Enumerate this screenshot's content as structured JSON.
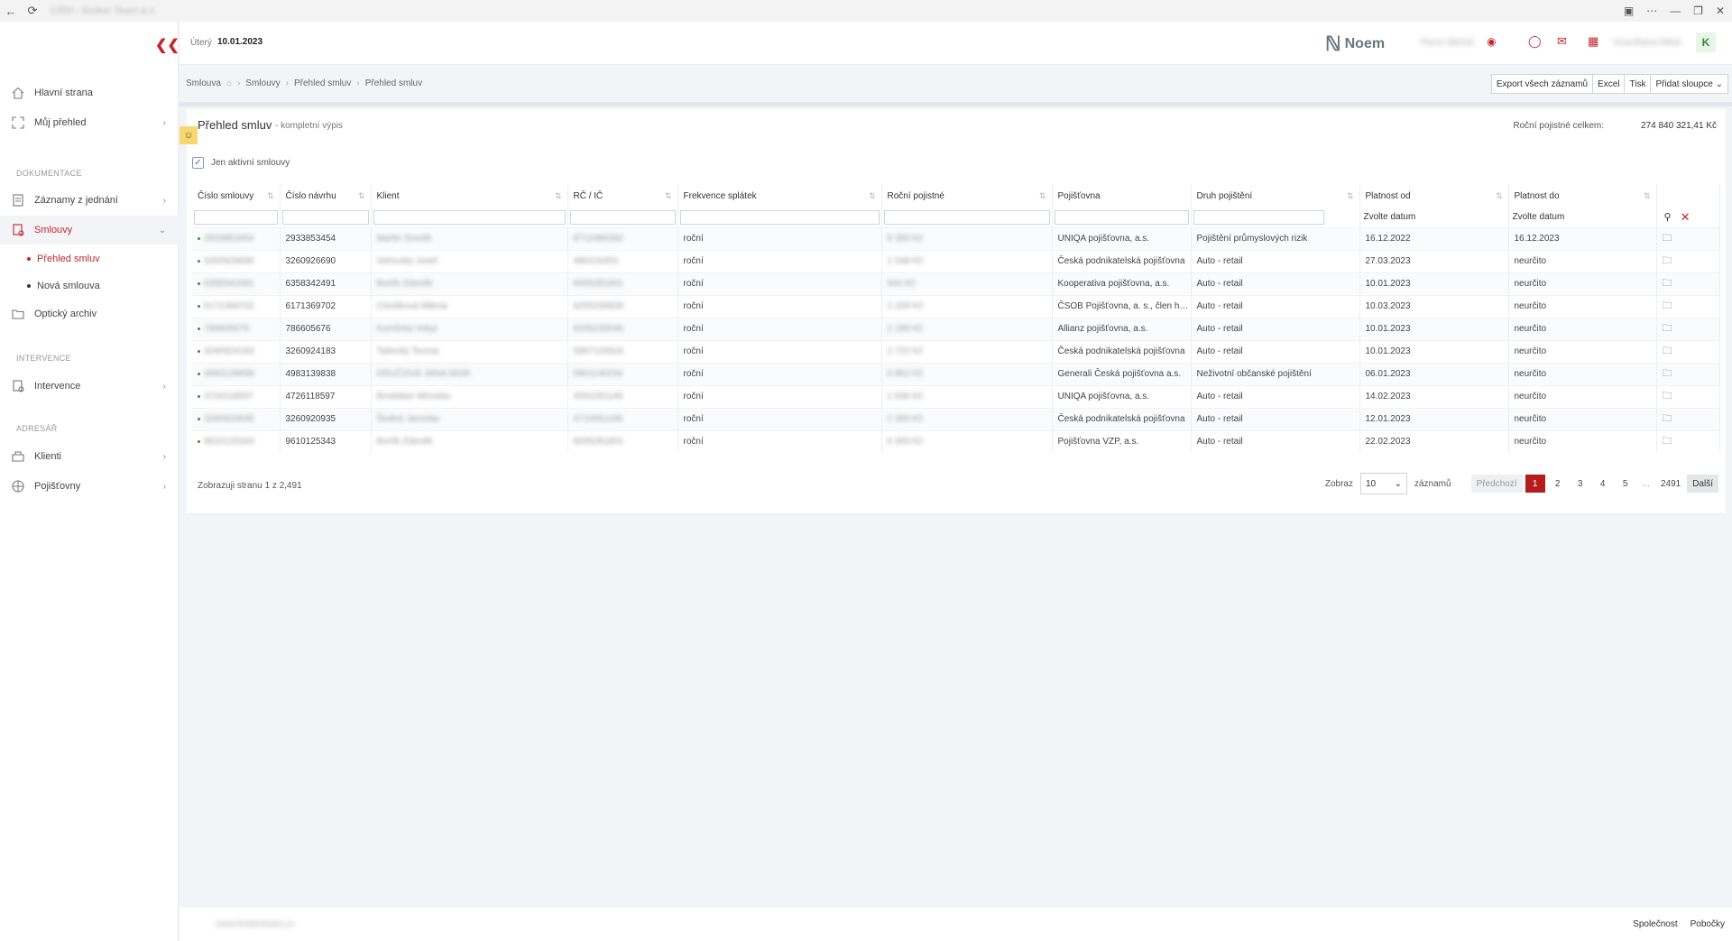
{
  "browser": {
    "title": "CRM - Broker Team a.s.",
    "back_icon": "arrow-left-icon",
    "reload_icon": "reload-icon"
  },
  "sidebar": {
    "items": [
      {
        "label": "Hlavní strana",
        "icon": "home-icon"
      },
      {
        "label": "Můj přehled",
        "icon": "expand-icon"
      },
      {
        "label": "Záznamy z jednání",
        "icon": "document-icon"
      },
      {
        "label": "Smlouvy",
        "icon": "contract-icon"
      },
      {
        "label": "Optický archiv",
        "icon": "folder-icon"
      },
      {
        "label": "Intervence",
        "icon": "intervention-icon"
      },
      {
        "label": "Klienti",
        "icon": "clients-icon"
      },
      {
        "label": "Pojišťovny",
        "icon": "globe-icon"
      }
    ],
    "sections": {
      "dokumentace": "DOKUMENTACE",
      "intervence": "INTERVENCE",
      "adresar": "ADRESÁŘ"
    },
    "sub_items": [
      {
        "label": "Přehled smluv"
      },
      {
        "label": "Nová smlouva"
      }
    ]
  },
  "header": {
    "day": "Úterý",
    "date": "10.01.2023",
    "logo": "Noem",
    "user_blur": "Pierre Michal",
    "user_name": "Kravdhana Miloš",
    "avatar": "K"
  },
  "breadcrumb": [
    "Smlouva",
    "Smlouvy",
    "Přehled smluv",
    "Přehled smluv"
  ],
  "actions": [
    "Export všech záznamů",
    "Excel",
    "Tisk",
    "Přidat sloupce"
  ],
  "card": {
    "title": "Přehled smluv",
    "subtitle": "- kompletní výpis",
    "total_label": "Roční pojistné celkem:",
    "total_value": "274 840 321,41 Kč",
    "only_active": "Jen aktivní smlouvy"
  },
  "table": {
    "columns": [
      "Číslo smlouvy",
      "Číslo návrhu",
      "Klient",
      "RČ / IČ",
      "Frekvence splátek",
      "Roční pojistné",
      "Pojišťovna",
      "Druh pojištění",
      "Platnost od",
      "Platnost do"
    ],
    "date_placeholder": "Zvolte datum",
    "rows": [
      {
        "cislo": "2933853454",
        "navrh": "2933853454",
        "klient": "Martin Smolík",
        "rc": "8712480392",
        "frekvence": "roční",
        "pojistne": "8 350 Kč",
        "pojistovna": "UNIQA pojišťovna, a.s.",
        "druh": "Pojištění průmyslových rizik",
        "od": "16.12.2022",
        "do": "16.12.2023"
      },
      {
        "cislo": "3260926690",
        "navrh": "3260926690",
        "klient": "Veřovský Josef",
        "rc": "480116453",
        "frekvence": "roční",
        "pojistne": "1 548 Kč",
        "pojistovna": "Česká podnikatelská pojišťovna",
        "druh": "Auto - retail",
        "od": "27.03.2023",
        "do": "neurčito"
      },
      {
        "cislo": "6358342491",
        "navrh": "6358342491",
        "klient": "Bortík Zdeněk",
        "rc": "6005281801",
        "frekvence": "roční",
        "pojistne": "944 Kč",
        "pojistovna": "Kooperativa pojišťovna, a.s.",
        "druh": "Auto - retail",
        "od": "10.01.2023",
        "do": "neurčito"
      },
      {
        "cislo": "6171369702",
        "navrh": "6171369702",
        "klient": "Cieslíková Milena",
        "rc": "6255230828",
        "frekvence": "roční",
        "pojistne": "2 228 Kč",
        "pojistovna": "ČSOB Pojišťovna, a. s., člen holdingu ČSOB",
        "druh": "Auto - retail",
        "od": "10.03.2023",
        "do": "neurčito"
      },
      {
        "cislo": "786605676",
        "navrh": "786605676",
        "klient": "Komůrka Vokyl",
        "rc": "6205230046",
        "frekvence": "roční",
        "pojistne": "2 188 Kč",
        "pojistovna": "Allianz pojišťovna, a.s.",
        "druh": "Auto - retail",
        "od": "10.01.2023",
        "do": "neurčito"
      },
      {
        "cislo": "3260924183",
        "navrh": "3260924183",
        "klient": "Tašecký Tereza",
        "rc": "5957120923",
        "frekvence": "roční",
        "pojistne": "2 722 Kč",
        "pojistovna": "Česká podnikatelská pojišťovna",
        "druh": "Auto - retail",
        "od": "10.01.2023",
        "do": "neurčito"
      },
      {
        "cislo": "4983139838",
        "navrh": "4983139838",
        "klient": "KRUČOVÁ JANA MGR.",
        "rc": "5901140234",
        "frekvence": "roční",
        "pojistne": "6 852 Kč",
        "pojistovna": "Generali Česká pojišťovna a.s.",
        "druh": "Neživotní občanské pojištění",
        "od": "06.01.2023",
        "do": "neurčito"
      },
      {
        "cislo": "4726118597",
        "navrh": "4726118597",
        "klient": "Brodskier Miroslav",
        "rc": "4002281145",
        "frekvence": "roční",
        "pojistne": "1 836 Kč",
        "pojistovna": "UNIQA pojišťovna, a.s.",
        "druh": "Auto - retail",
        "od": "14.02.2023",
        "do": "neurčito"
      },
      {
        "cislo": "3260920935",
        "navrh": "3260920935",
        "klient": "Šedivý Jaroslav",
        "rc": "4710051166",
        "frekvence": "roční",
        "pojistne": "2 305 Kč",
        "pojistovna": "Česká podnikatelská pojišťovna",
        "druh": "Auto - retail",
        "od": "12.01.2023",
        "do": "neurčito"
      },
      {
        "cislo": "9610125343",
        "navrh": "9610125343",
        "klient": "Bortík Zdeněk",
        "rc": "6005281801",
        "frekvence": "roční",
        "pojistne": "6 300 Kč",
        "pojistovna": "Pojišťovna VZP, a.s.",
        "druh": "Auto - retail",
        "od": "22.02.2023",
        "do": "neurčito"
      }
    ]
  },
  "pager": {
    "info": "Zobrazuji stranu 1 z 2,491",
    "show_label": "Zobraz",
    "page_size": "10",
    "records_label": "záznamů",
    "prev": "Předchozí",
    "pages": [
      "1",
      "2",
      "3",
      "4",
      "5"
    ],
    "ellipsis": "...",
    "last": "2491",
    "next": "Další"
  },
  "footer": {
    "site": "www.brokerteam.cz",
    "links": [
      "Společnost",
      "Pobočky"
    ]
  },
  "colors": {
    "accent": "#c0272d",
    "active_page": "#b71c1c",
    "success": "#2a9a2a"
  }
}
